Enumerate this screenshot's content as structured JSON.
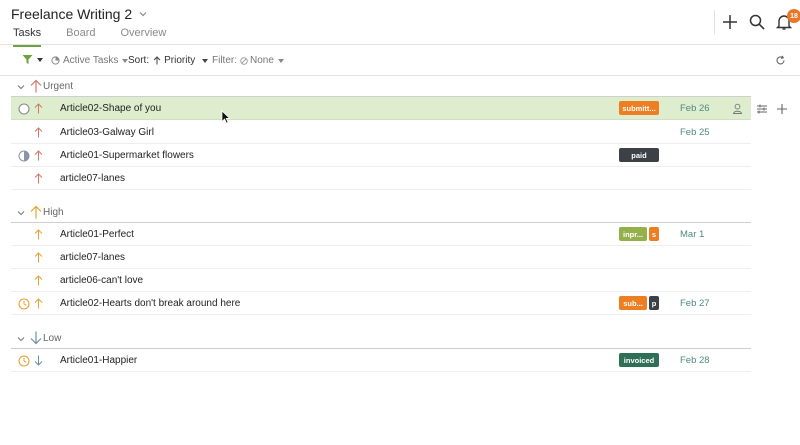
{
  "header": {
    "project_title": "Freelance Writing 2",
    "tabs": [
      "Tasks",
      "Board",
      "Overview"
    ],
    "active_tab": "Tasks",
    "notification_count": "18"
  },
  "toolbar": {
    "active_tasks_label": "Active Tasks",
    "sort_label": "Sort:",
    "sort_value": "Priority",
    "filter_label": "Filter:",
    "filter_value": "None"
  },
  "colors": {
    "accent_green": "#6aa33e",
    "highlight_row": "#deedcd",
    "urgent": "#d2786a",
    "high": "#e5a232",
    "low": "#6b8fa7",
    "date": "#4e8a82",
    "tag_orange": "#ed7f22",
    "tag_dark": "#3c4147",
    "tag_olive": "#93b04b",
    "tag_green": "#2f6f56"
  },
  "groups": [
    {
      "name": "Urgent",
      "tasks": [
        {
          "name": "Article02-Shape of you",
          "tag": "submitt...",
          "date": "Feb 26",
          "status": "circle-empty"
        },
        {
          "name": "Article03-Galway Girl",
          "date": "Feb 25",
          "status": "none"
        },
        {
          "name": "Article01-Supermarket flowers",
          "tag": "paid",
          "status": "half"
        },
        {
          "name": "article07-lanes",
          "status": "none"
        }
      ]
    },
    {
      "name": "High",
      "tasks": [
        {
          "name": "Article01-Perfect",
          "tag": "inpr...",
          "tag2": "s",
          "date": "Mar 1",
          "status": "none"
        },
        {
          "name": "article07-lanes",
          "status": "none"
        },
        {
          "name": "article06-can't love",
          "status": "none"
        },
        {
          "name": "Article02-Hearts don't break around here",
          "tag": "sub...",
          "tag2": "p",
          "date": "Feb 27",
          "status": "clock"
        }
      ]
    },
    {
      "name": "Low",
      "tasks": [
        {
          "name": "Article01-Happier",
          "tag": "invoiced",
          "date": "Feb 28",
          "status": "clock"
        }
      ]
    }
  ]
}
